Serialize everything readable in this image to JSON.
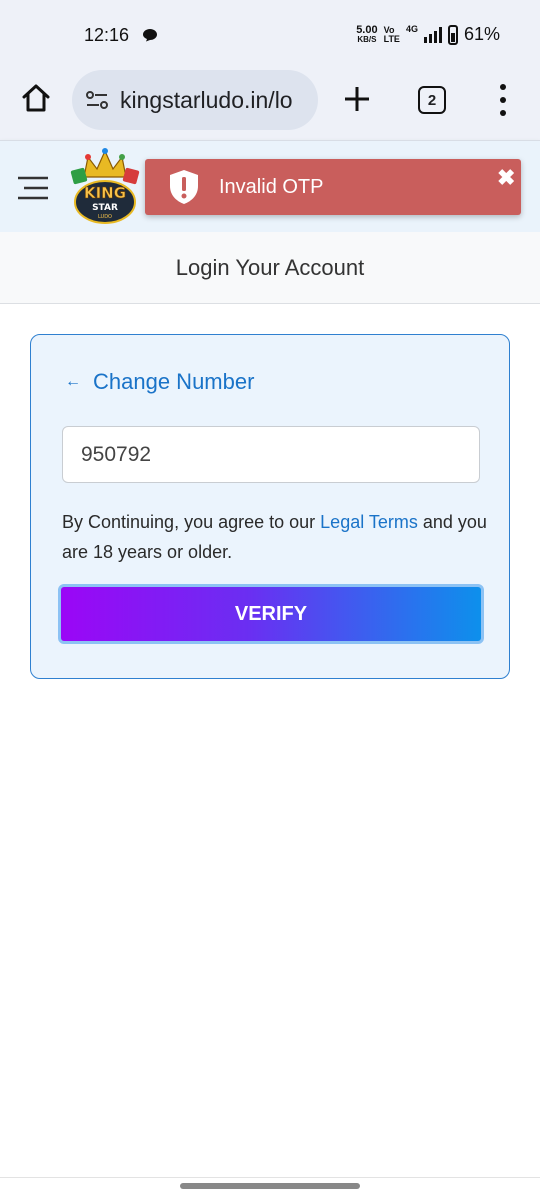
{
  "status_bar": {
    "time": "12:16",
    "net_speed_value": "5.00",
    "net_speed_unit": "KB/S",
    "volte_top": "Vo",
    "volte_bottom": "LTE",
    "network": "4G",
    "battery": "61%"
  },
  "browser": {
    "url": "kingstarludo.in/lo",
    "tab_count": "2"
  },
  "header": {
    "logo_text_top": "KING",
    "logo_text_mid": "STAR",
    "logo_text_bottom": "LUDO"
  },
  "toast": {
    "message": "Invalid OTP",
    "color": "#c95e5c"
  },
  "page": {
    "title": "Login Your Account"
  },
  "form": {
    "change_number_arrow": "←",
    "change_number_label": "Change Number",
    "otp_value": "950792",
    "terms_prefix": "By Continuing, you agree to our ",
    "terms_link": "Legal Terms",
    "terms_suffix": " and you are 18 years or older.",
    "verify_label": "VERIFY"
  },
  "colors": {
    "accent": "#1a73c8",
    "card_border": "#2f80d0",
    "button_gradient_start": "#9b06f6",
    "button_gradient_end": "#0d90ec"
  }
}
